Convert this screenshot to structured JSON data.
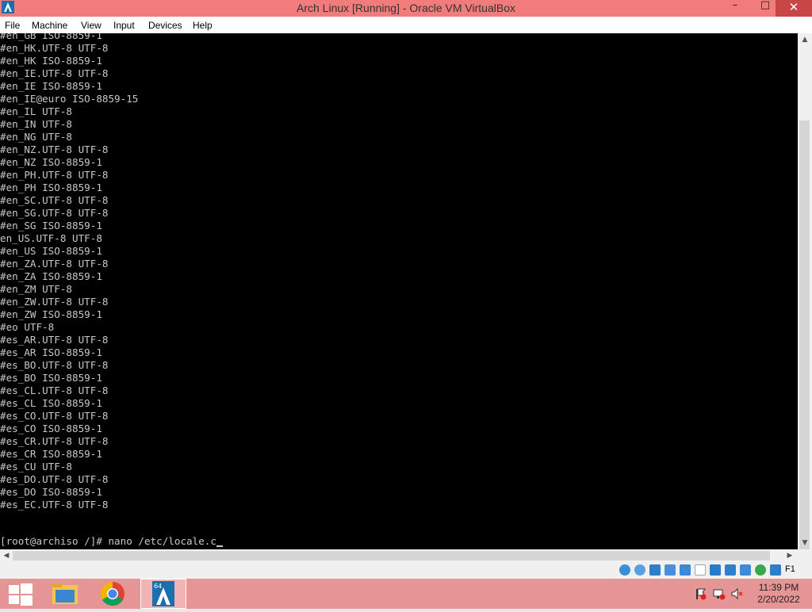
{
  "window": {
    "title": "Arch Linux [Running] - Oracle VM VirtualBox",
    "minimize": "–",
    "maximize": "□",
    "close": "✕"
  },
  "menu": [
    "File",
    "Machine",
    "View",
    "Input",
    "Devices",
    "Help"
  ],
  "console": {
    "lines": [
      "#en_GB ISO-8859-1",
      "#en_HK.UTF-8 UTF-8",
      "#en_HK ISO-8859-1",
      "#en_IE.UTF-8 UTF-8",
      "#en_IE ISO-8859-1",
      "#en_IE@euro ISO-8859-15",
      "#en_IL UTF-8",
      "#en_IN UTF-8",
      "#en_NG UTF-8",
      "#en_NZ.UTF-8 UTF-8",
      "#en_NZ ISO-8859-1",
      "#en_PH.UTF-8 UTF-8",
      "#en_PH ISO-8859-1",
      "#en_SC.UTF-8 UTF-8",
      "#en_SG.UTF-8 UTF-8",
      "#en_SG ISO-8859-1",
      "en_US.UTF-8 UTF-8",
      "#en_US ISO-8859-1",
      "#en_ZA.UTF-8 UTF-8",
      "#en_ZA ISO-8859-1",
      "#en_ZM UTF-8",
      "#en_ZW.UTF-8 UTF-8",
      "#en_ZW ISO-8859-1",
      "#eo UTF-8",
      "#es_AR.UTF-8 UTF-8",
      "#es_AR ISO-8859-1",
      "#es_BO.UTF-8 UTF-8",
      "#es_BO ISO-8859-1",
      "#es_CL.UTF-8 UTF-8",
      "#es_CL ISO-8859-1",
      "#es_CO.UTF-8 UTF-8",
      "#es_CO ISO-8859-1",
      "#es_CR.UTF-8 UTF-8",
      "#es_CR ISO-8859-1",
      "#es_CU UTF-8",
      "#es_DO.UTF-8 UTF-8",
      "#es_DO ISO-8859-1",
      "#es_EC.UTF-8 UTF-8"
    ],
    "prompt": "[root@archiso /]# nano /etc/locale.c"
  },
  "statusbar": {
    "icons": [
      "hard-disk-icon",
      "optical-drive-icon",
      "audio-icon",
      "network-icon",
      "usb-icon",
      "shared-folders-icon",
      "display-icon",
      "video-capture-icon",
      "cpu-icon",
      "mouse-integration-icon",
      "keyboard-icon"
    ],
    "host_key": "F1"
  },
  "taskbar": {
    "apps": [
      "start-button",
      "file-explorer",
      "google-chrome",
      "virtualbox-arch-linux"
    ],
    "tray_icons": [
      "action-center-flag-icon",
      "network-icon",
      "volume-muted-icon"
    ],
    "time": "11:39 PM",
    "date": "2/20/2022"
  },
  "colors": {
    "titlebar": "#f27b7b",
    "taskbar": "#e69494",
    "console_bg": "#000000",
    "console_text": "#c7c7c7"
  }
}
